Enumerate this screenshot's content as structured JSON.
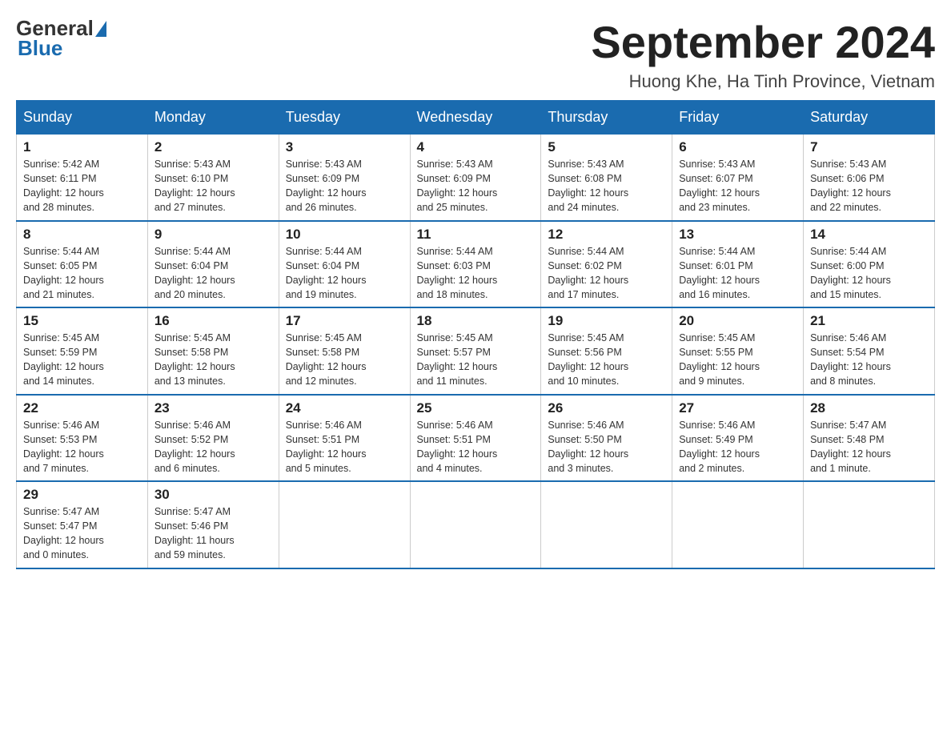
{
  "header": {
    "logo_general": "General",
    "logo_blue": "Blue",
    "month_title": "September 2024",
    "location": "Huong Khe, Ha Tinh Province, Vietnam"
  },
  "weekdays": [
    "Sunday",
    "Monday",
    "Tuesday",
    "Wednesday",
    "Thursday",
    "Friday",
    "Saturday"
  ],
  "weeks": [
    [
      {
        "day": "1",
        "sunrise": "5:42 AM",
        "sunset": "6:11 PM",
        "daylight": "12 hours and 28 minutes."
      },
      {
        "day": "2",
        "sunrise": "5:43 AM",
        "sunset": "6:10 PM",
        "daylight": "12 hours and 27 minutes."
      },
      {
        "day": "3",
        "sunrise": "5:43 AM",
        "sunset": "6:09 PM",
        "daylight": "12 hours and 26 minutes."
      },
      {
        "day": "4",
        "sunrise": "5:43 AM",
        "sunset": "6:09 PM",
        "daylight": "12 hours and 25 minutes."
      },
      {
        "day": "5",
        "sunrise": "5:43 AM",
        "sunset": "6:08 PM",
        "daylight": "12 hours and 24 minutes."
      },
      {
        "day": "6",
        "sunrise": "5:43 AM",
        "sunset": "6:07 PM",
        "daylight": "12 hours and 23 minutes."
      },
      {
        "day": "7",
        "sunrise": "5:43 AM",
        "sunset": "6:06 PM",
        "daylight": "12 hours and 22 minutes."
      }
    ],
    [
      {
        "day": "8",
        "sunrise": "5:44 AM",
        "sunset": "6:05 PM",
        "daylight": "12 hours and 21 minutes."
      },
      {
        "day": "9",
        "sunrise": "5:44 AM",
        "sunset": "6:04 PM",
        "daylight": "12 hours and 20 minutes."
      },
      {
        "day": "10",
        "sunrise": "5:44 AM",
        "sunset": "6:04 PM",
        "daylight": "12 hours and 19 minutes."
      },
      {
        "day": "11",
        "sunrise": "5:44 AM",
        "sunset": "6:03 PM",
        "daylight": "12 hours and 18 minutes."
      },
      {
        "day": "12",
        "sunrise": "5:44 AM",
        "sunset": "6:02 PM",
        "daylight": "12 hours and 17 minutes."
      },
      {
        "day": "13",
        "sunrise": "5:44 AM",
        "sunset": "6:01 PM",
        "daylight": "12 hours and 16 minutes."
      },
      {
        "day": "14",
        "sunrise": "5:44 AM",
        "sunset": "6:00 PM",
        "daylight": "12 hours and 15 minutes."
      }
    ],
    [
      {
        "day": "15",
        "sunrise": "5:45 AM",
        "sunset": "5:59 PM",
        "daylight": "12 hours and 14 minutes."
      },
      {
        "day": "16",
        "sunrise": "5:45 AM",
        "sunset": "5:58 PM",
        "daylight": "12 hours and 13 minutes."
      },
      {
        "day": "17",
        "sunrise": "5:45 AM",
        "sunset": "5:58 PM",
        "daylight": "12 hours and 12 minutes."
      },
      {
        "day": "18",
        "sunrise": "5:45 AM",
        "sunset": "5:57 PM",
        "daylight": "12 hours and 11 minutes."
      },
      {
        "day": "19",
        "sunrise": "5:45 AM",
        "sunset": "5:56 PM",
        "daylight": "12 hours and 10 minutes."
      },
      {
        "day": "20",
        "sunrise": "5:45 AM",
        "sunset": "5:55 PM",
        "daylight": "12 hours and 9 minutes."
      },
      {
        "day": "21",
        "sunrise": "5:46 AM",
        "sunset": "5:54 PM",
        "daylight": "12 hours and 8 minutes."
      }
    ],
    [
      {
        "day": "22",
        "sunrise": "5:46 AM",
        "sunset": "5:53 PM",
        "daylight": "12 hours and 7 minutes."
      },
      {
        "day": "23",
        "sunrise": "5:46 AM",
        "sunset": "5:52 PM",
        "daylight": "12 hours and 6 minutes."
      },
      {
        "day": "24",
        "sunrise": "5:46 AM",
        "sunset": "5:51 PM",
        "daylight": "12 hours and 5 minutes."
      },
      {
        "day": "25",
        "sunrise": "5:46 AM",
        "sunset": "5:51 PM",
        "daylight": "12 hours and 4 minutes."
      },
      {
        "day": "26",
        "sunrise": "5:46 AM",
        "sunset": "5:50 PM",
        "daylight": "12 hours and 3 minutes."
      },
      {
        "day": "27",
        "sunrise": "5:46 AM",
        "sunset": "5:49 PM",
        "daylight": "12 hours and 2 minutes."
      },
      {
        "day": "28",
        "sunrise": "5:47 AM",
        "sunset": "5:48 PM",
        "daylight": "12 hours and 1 minute."
      }
    ],
    [
      {
        "day": "29",
        "sunrise": "5:47 AM",
        "sunset": "5:47 PM",
        "daylight": "12 hours and 0 minutes."
      },
      {
        "day": "30",
        "sunrise": "5:47 AM",
        "sunset": "5:46 PM",
        "daylight": "11 hours and 59 minutes."
      },
      null,
      null,
      null,
      null,
      null
    ]
  ]
}
